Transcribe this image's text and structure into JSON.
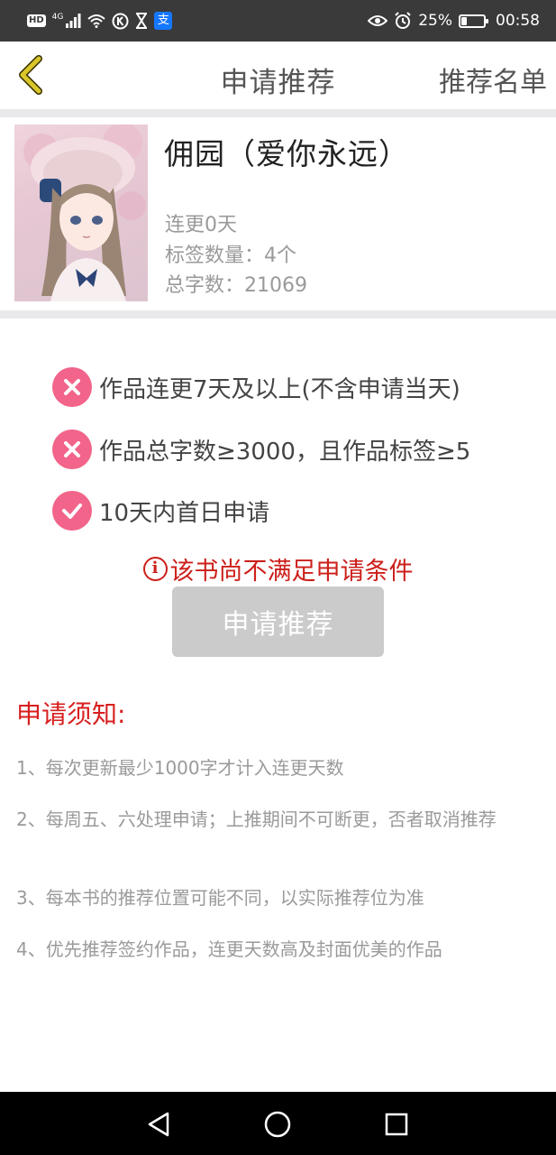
{
  "status_bar": {
    "hd": "HD",
    "network": "4G",
    "battery_percent": "25%",
    "battery_level": 0.25,
    "time": "00:58",
    "alipay_glyph": "支",
    "icons": [
      "hd-icon",
      "signal-icon",
      "wifi-icon",
      "k-icon",
      "hourglass-icon",
      "alipay-icon",
      "eye-icon",
      "alarm-icon",
      "battery-icon"
    ]
  },
  "nav": {
    "title": "申请推荐",
    "action": "推荐名单",
    "back_icon": "chevron-left-icon",
    "accent": "#c8b820"
  },
  "book": {
    "title": "佣园（爱你永远）",
    "streak": "连更0天",
    "tags": "标签数量：4个",
    "words": "总字数：21069"
  },
  "requirements": [
    {
      "text": "作品连更7天及以上(不含申请当天)",
      "met": false,
      "icon": "x-icon"
    },
    {
      "text": "作品总字数≥3000，且作品标签≥5",
      "met": false,
      "icon": "x-icon"
    },
    {
      "text": "10天内首日申请",
      "met": true,
      "icon": "check-icon"
    }
  ],
  "warning": {
    "icon_glyph": "i",
    "text": "该书尚不满足申请条件"
  },
  "apply_button": "申请推荐",
  "notice": {
    "heading": "申请须知:",
    "items": [
      "1、每次更新最少1000字才计入连更天数",
      "2、每周五、六处理申请；上推期间不可断更，否者取消推荐",
      "3、每本书的推荐位置可能不同，以实际推荐位为准",
      "4、优先推荐签约作品，连更天数高及封面优美的作品"
    ]
  },
  "colors": {
    "pink": "#f2648a",
    "red": "#cc1f1a",
    "button_disabled": "#cbcbcb",
    "status_bar": "#3a3a3a"
  }
}
